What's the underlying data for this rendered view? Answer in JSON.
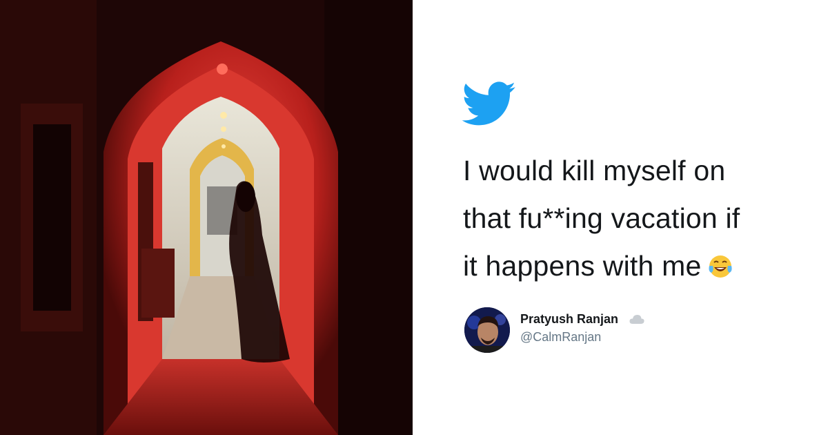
{
  "photo": {
    "description_icon": "haunted-corridor-photo"
  },
  "tweet": {
    "platform_icon": "twitter-bird-icon",
    "lines": [
      "I would kill myself on",
      "that fu**ing vacation if",
      "it happens with me"
    ],
    "emoji": "face-with-tears-of-joy",
    "author": {
      "name": "Pratyush Ranjan",
      "name_icon": "cloud-icon",
      "handle": "@CalmRanjan"
    }
  },
  "colors": {
    "twitter_blue": "#1da1f2",
    "text": "#14171a",
    "handle": "#657786"
  }
}
